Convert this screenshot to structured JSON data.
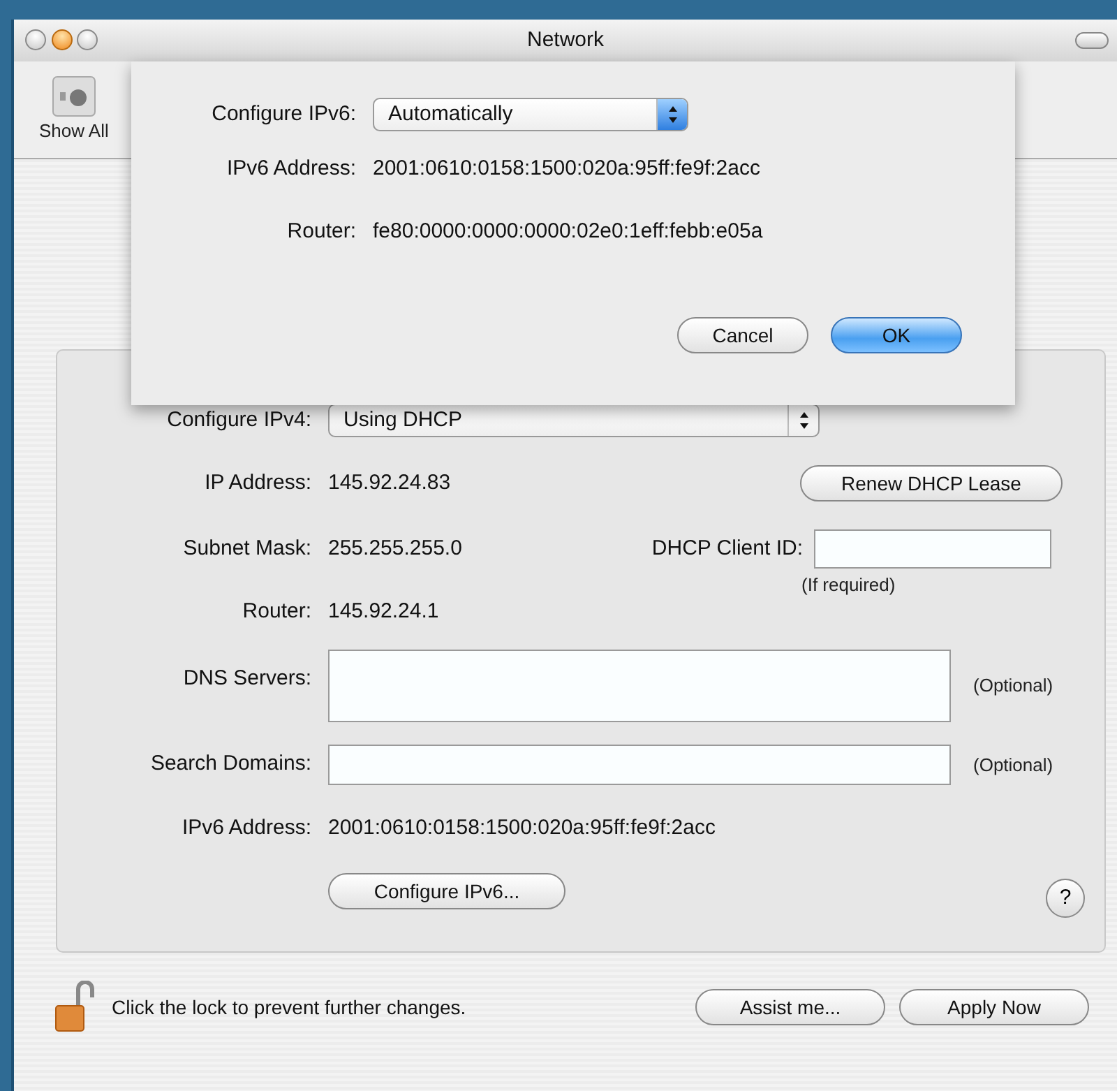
{
  "window": {
    "title": "Network"
  },
  "toolbar": {
    "items": [
      {
        "label": "Show All",
        "kind": "showall"
      }
    ]
  },
  "ipv4": {
    "configure_label": "Configure IPv4:",
    "configure_value": "Using DHCP",
    "ip_label": "IP Address:",
    "ip_value": "145.92.24.83",
    "renew_button": "Renew DHCP Lease",
    "subnet_label": "Subnet Mask:",
    "subnet_value": "255.255.255.0",
    "client_id_label": "DHCP Client ID:",
    "client_id_hint": "(If required)",
    "router_label": "Router:",
    "router_value": "145.92.24.1",
    "dns_label": "DNS Servers:",
    "dns_note": "(Optional)",
    "search_label": "Search Domains:",
    "search_note": "(Optional)",
    "ipv6_label": "IPv6 Address:",
    "ipv6_value": "2001:0610:0158:1500:020a:95ff:fe9f:2acc",
    "configure_ipv6_button": "Configure IPv6...",
    "help_button": "?"
  },
  "sheet": {
    "configure_label": "Configure IPv6:",
    "configure_value": "Automatically",
    "address_label": "IPv6 Address:",
    "address_value": "2001:0610:0158:1500:020a:95ff:fe9f:2acc",
    "router_label": "Router:",
    "router_value": "fe80:0000:0000:0000:02e0:1eff:febb:e05a",
    "buttons": [
      {
        "label": "Cancel",
        "kind": "plain"
      },
      {
        "label": "OK",
        "kind": "default"
      }
    ]
  },
  "footer": {
    "lock_text": "Click the lock to prevent further changes.",
    "buttons": [
      "Assist me...",
      "Apply Now"
    ]
  }
}
